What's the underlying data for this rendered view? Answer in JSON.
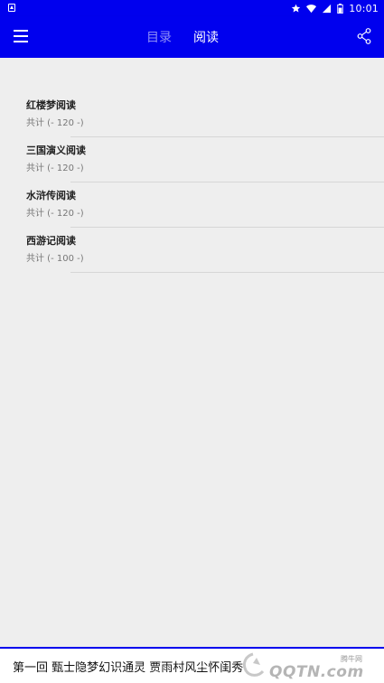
{
  "status_bar": {
    "time": "10:01"
  },
  "app_bar": {
    "tabs": [
      {
        "label": "目录",
        "active": false
      },
      {
        "label": "阅读",
        "active": true
      }
    ]
  },
  "books": [
    {
      "title": "红楼梦阅读",
      "count": "共计 (- 120 -)"
    },
    {
      "title": "三国演义阅读",
      "count": "共计 (- 120 -)"
    },
    {
      "title": "水浒传阅读",
      "count": "共计 (- 120 -)"
    },
    {
      "title": "西游记阅读",
      "count": "共计 (- 100 -)"
    }
  ],
  "bottom_bar": {
    "text": "第一回 甄士隐梦幻识通灵 贾雨村风尘怀闺秀",
    "watermark_text": "QQTN.com",
    "watermark_small": "腾牛网"
  },
  "colors": {
    "primary": "#0000ee",
    "background": "#eeeeee"
  }
}
